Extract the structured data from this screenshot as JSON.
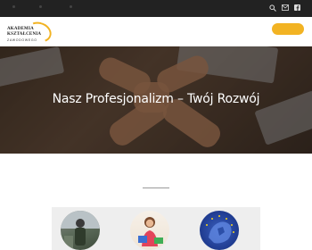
{
  "brand": {
    "logo_line1": "AKADEMIA",
    "logo_line2": "KSZTAŁCENIA",
    "logo_line3": "ZAWODOWEGO",
    "accent_color": "#f2b323"
  },
  "topbar": {
    "icons": [
      "search-icon",
      "mail-icon",
      "facebook-icon"
    ]
  },
  "hero": {
    "title": "Nasz Profesjonalizm – Twój Rozwój"
  },
  "cards": [
    {
      "image": "photo-person-outdoor"
    },
    {
      "image": "photo-teacher-woman"
    },
    {
      "image": "photo-europe-map-eu-stars"
    }
  ]
}
